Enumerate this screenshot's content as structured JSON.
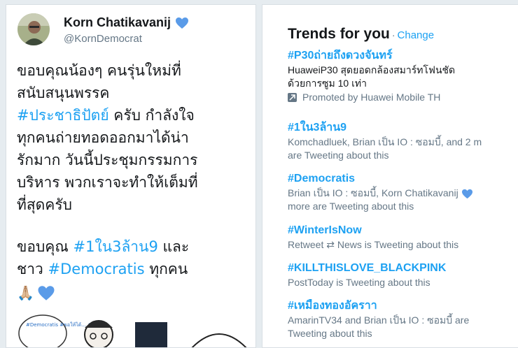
{
  "tweet": {
    "display_name": "Korn Chatikavanij",
    "handle": "@KornDemocrat",
    "line1": "ขอบคุณน้องๆ คนรุ่นใหม่ที่",
    "line2": "สนับสนุนพรรค",
    "hashtag1": "#ประชาธิปัตย์",
    "line3_rest": " ครับ กำลังใจ",
    "line4": "ทุกคนถ่ายทอดออกมาได้น่า",
    "line5": "รักมาก วันนี้ประชุมกรรมการ",
    "line6": "บริหาร พวกเราจะทำให้เต็มที่",
    "line7": "ที่สุดครับ",
    "thanks_prefix": "ขอบคุณ ",
    "hashtag2": "#1ใน3ล้าน9",
    "thanks_and": " และ",
    "folks_prefix": "ชาว ",
    "hashtag3": "#Democratis",
    "everyone": " ทุกคน",
    "emoji_hands": "🙏🏼",
    "cartoon_text": "#Democratis #ขอให้ได้... #ปชป"
  },
  "trends": {
    "title": "Trends for you",
    "separator": "·",
    "change_label": "Change",
    "items": [
      {
        "tag": "#P30ถ่ายถึงดวงจันทร์",
        "desc1": "HuaweiP30 สุดยอดกล้องสมาร์ทโฟนชัด",
        "desc2": "ด้วยการซูม 10 เท่า",
        "promoted": "Promoted by Huawei Mobile TH"
      },
      {
        "tag": "#1ใน3ล้าน9",
        "ctx1": "Komchadluek, Brian เป็น IO : ซอมบี้, and 2 m",
        "ctx2": "are Tweeting about this"
      },
      {
        "tag": "#Democratis",
        "ctx1a": "Brian เป็น IO : ซอมบี้, Korn Chatikavanij",
        "ctx2": "more are Tweeting about this"
      },
      {
        "tag": "#WinterIsNow",
        "ctx1a": "Retweet",
        "ctx1_glyph": "⇄",
        "ctx1b": "News is Tweeting about this"
      },
      {
        "tag": "#KILLTHISLOVE_BLACKPINK",
        "ctx1": "PostToday is Tweeting about this"
      },
      {
        "tag": "#เหมืองทองอัคราา",
        "ctx1": "AmarinTV34 and Brian เป็น IO : ซอมบี้ are",
        "ctx2": "Tweeting about this"
      }
    ]
  },
  "colors": {
    "accent": "#1da1f2",
    "text": "#14171a",
    "muted": "#657786",
    "heart": "#5a9be8"
  }
}
